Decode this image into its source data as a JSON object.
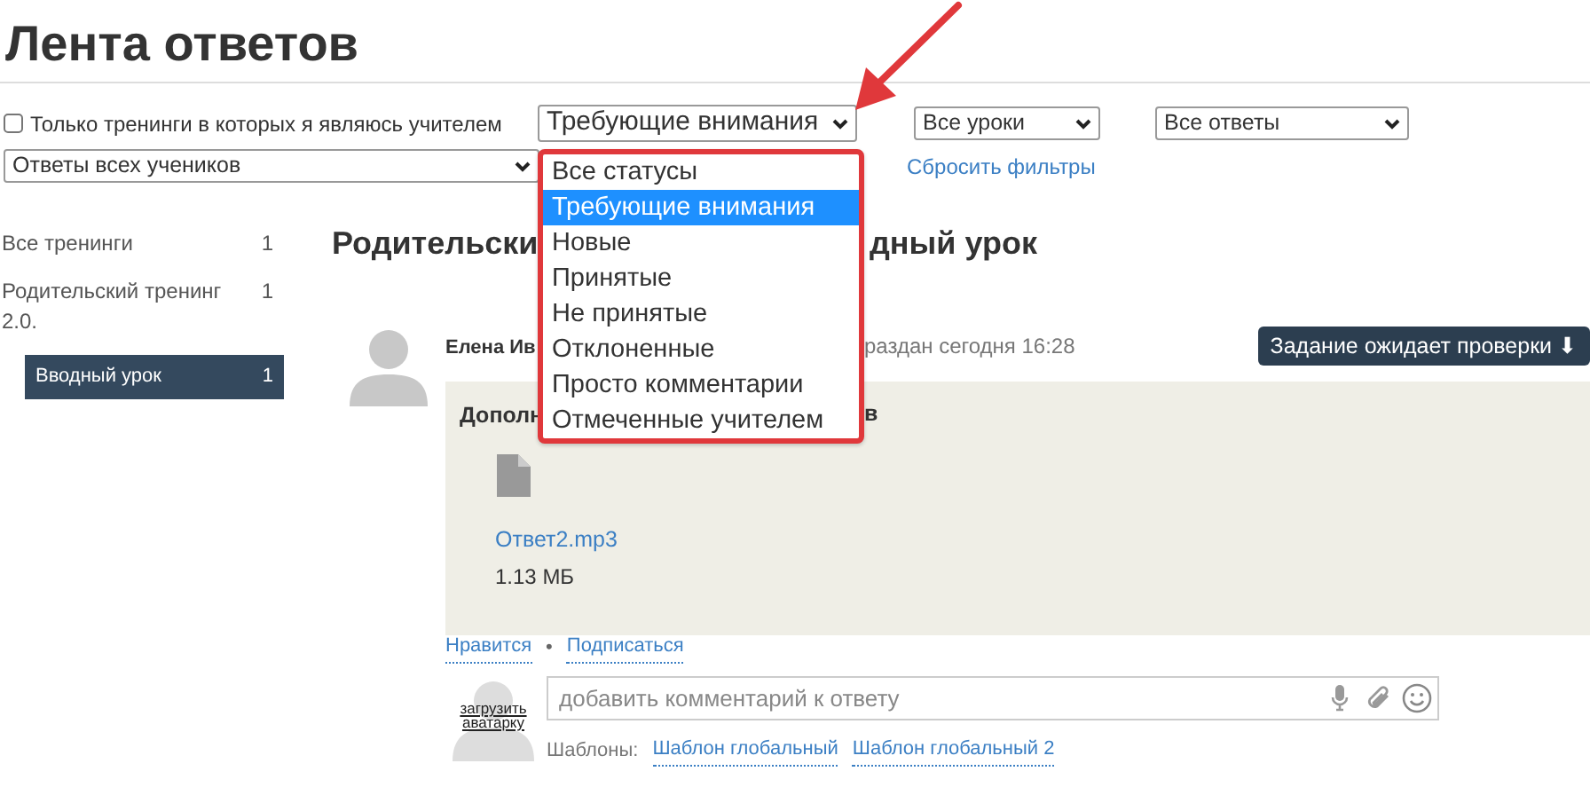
{
  "page_title": "Лента ответов",
  "filters": {
    "teacher_only": {
      "label": "Только тренинги в которых я являюсь учителем",
      "checked": false
    },
    "status_select": {
      "value": "Требующие внимания",
      "open": true
    },
    "lesson_select": {
      "value": "Все уроки"
    },
    "answers_select": {
      "value": "Все ответы"
    },
    "students_select": {
      "value": "Ответы всех учеников"
    },
    "reset_link": "Сбросить фильтры"
  },
  "status_options": [
    {
      "label": "Все статусы",
      "selected": false
    },
    {
      "label": "Требующие внимания",
      "selected": true
    },
    {
      "label": "Новые",
      "selected": false
    },
    {
      "label": "Принятые",
      "selected": false
    },
    {
      "label": "Не принятые",
      "selected": false
    },
    {
      "label": "Отклоненные",
      "selected": false
    },
    {
      "label": "Просто комментарии",
      "selected": false
    },
    {
      "label": "Отмеченные учителем",
      "selected": false
    }
  ],
  "sidebar": [
    {
      "label": "Все тренинги",
      "count": "1",
      "selected": false
    },
    {
      "label": "Родительский тренинг 2.0.",
      "count": "1",
      "selected": false,
      "children": [
        {
          "label": "Вводный урок",
          "count": "1",
          "selected": true
        }
      ]
    }
  ],
  "content": {
    "heading_left": "Родительски",
    "heading_right": "дный урок",
    "author_name": "Елена Ив",
    "submitted_text": "раздан сегодня 16:28",
    "status_button": "Задание ожидает проверки ⬇",
    "card": {
      "title_left": "Дополн",
      "title_right": "в",
      "file": {
        "name": "Ответ2.mp3",
        "size": "1.13 МБ"
      }
    },
    "actions": [
      "Нравится",
      "Подписаться"
    ],
    "separator": "•",
    "comment": {
      "avatar_text": "загрузить аватарку",
      "placeholder": "добавить комментарий к ответу"
    },
    "templates_label": "Шаблоны:",
    "templates": [
      "Шаблон глобальный",
      "Шаблон глобальный 2"
    ]
  }
}
